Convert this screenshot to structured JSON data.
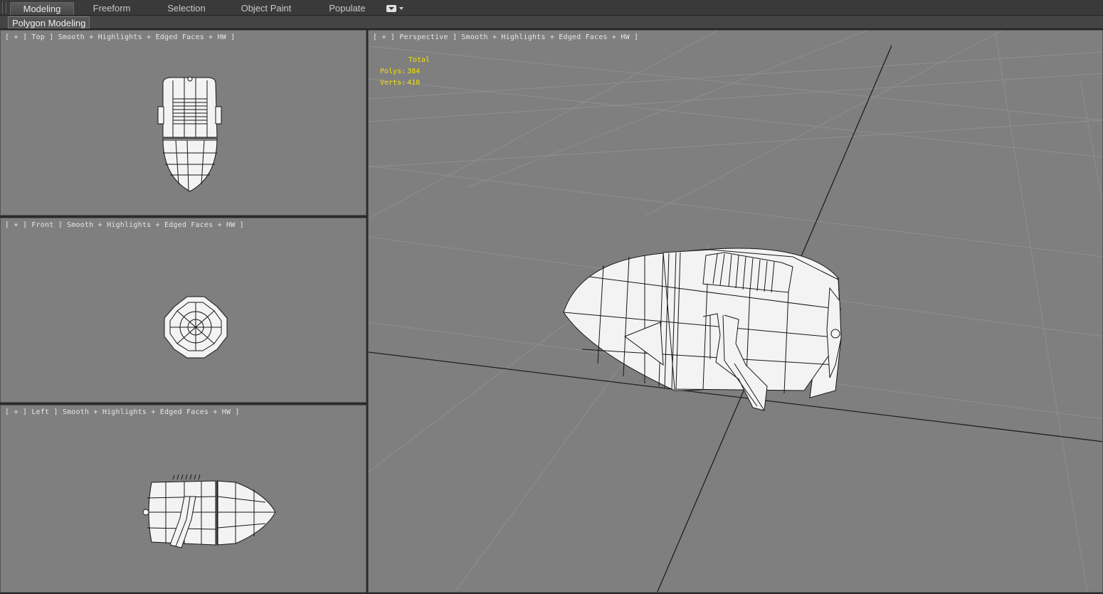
{
  "ribbon": {
    "tabs": [
      "Modeling",
      "Freeform",
      "Selection",
      "Object Paint",
      "Populate"
    ],
    "active_tab": "Modeling",
    "panel_label": "Polygon Modeling"
  },
  "viewports": {
    "top": {
      "label": "[ + ] Top ] Smooth + Highlights + Edged Faces + HW ]"
    },
    "front": {
      "label": "[ + ] Front ] Smooth + Highlights + Edged Faces + HW ]"
    },
    "left": {
      "label": "[ + ] Left ] Smooth + Highlights + Edged Faces + HW ]"
    },
    "perspective": {
      "label": "[ + ] Perspective ] Smooth + Highlights + Edged Faces + HW ]",
      "stats": {
        "header": "Total",
        "polys_label": "Polys:",
        "polys": "384",
        "verts_label": "Verts:",
        "verts": "410"
      }
    }
  },
  "colors": {
    "viewport_bg": "#7f7f7f",
    "stats_text": "#f2e200",
    "mesh_fill": "#f3f3f3",
    "wire": "#161616"
  }
}
